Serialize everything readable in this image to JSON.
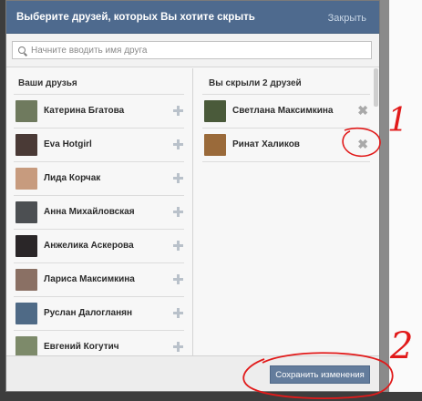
{
  "dialog": {
    "title": "Выберите друзей, которых Вы хотите скрыть",
    "close_label": "Закрыть"
  },
  "search": {
    "placeholder": "Начните вводить имя друга"
  },
  "friends": {
    "heading": "Ваши друзья",
    "items": [
      {
        "name": "Катерина Бгатова",
        "avatar_color": "#6f7a5e"
      },
      {
        "name": "Eva Hotgirl",
        "avatar_color": "#4a3a36"
      },
      {
        "name": "Лида Корчак",
        "avatar_color": "#c79b7e"
      },
      {
        "name": "Анна Михайловская",
        "avatar_color": "#4c4f52"
      },
      {
        "name": "Анжелика Аскерова",
        "avatar_color": "#2a2628"
      },
      {
        "name": "Лариса Максимкина",
        "avatar_color": "#8a7064"
      },
      {
        "name": "Руслан Далогланян",
        "avatar_color": "#4f6a86"
      },
      {
        "name": "Евгений Когутич",
        "avatar_color": "#7d8a6a"
      }
    ]
  },
  "hidden": {
    "heading": "Вы скрыли 2 друзей",
    "items": [
      {
        "name": "Светлана Максимкина",
        "avatar_color": "#4a5a3a"
      },
      {
        "name": "Ринат Халиков",
        "avatar_color": "#9a6a3a"
      }
    ]
  },
  "footer": {
    "save_label": "Сохранить изменения"
  },
  "annotations": {
    "label_one": "1",
    "label_two": "2",
    "color": "#e11a1a"
  }
}
